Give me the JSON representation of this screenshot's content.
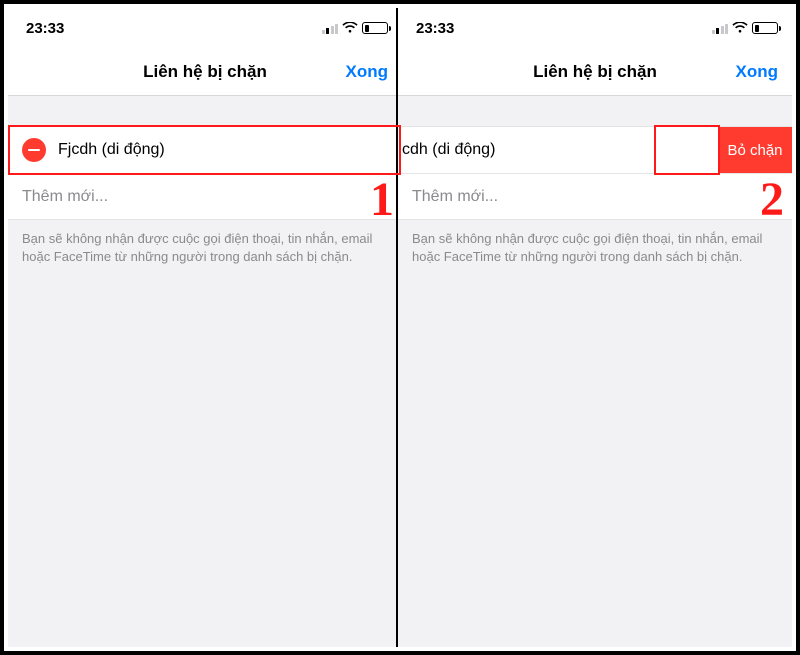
{
  "statusbar": {
    "time": "23:33"
  },
  "navbar": {
    "title": "Liên hệ bị chặn",
    "done": "Xong"
  },
  "contact": {
    "name_full": "Fjcdh (di động)",
    "name_clipped": "cdh (di động)"
  },
  "unblock_label": "Bỏ chặn",
  "addnew_label": "Thêm mới...",
  "footer_note": "Bạn sẽ không nhận được cuộc gọi điện thoại, tin nhắn, email hoặc FaceTime từ những người trong danh sách bị chặn.",
  "steps": {
    "one": "1",
    "two": "2"
  }
}
